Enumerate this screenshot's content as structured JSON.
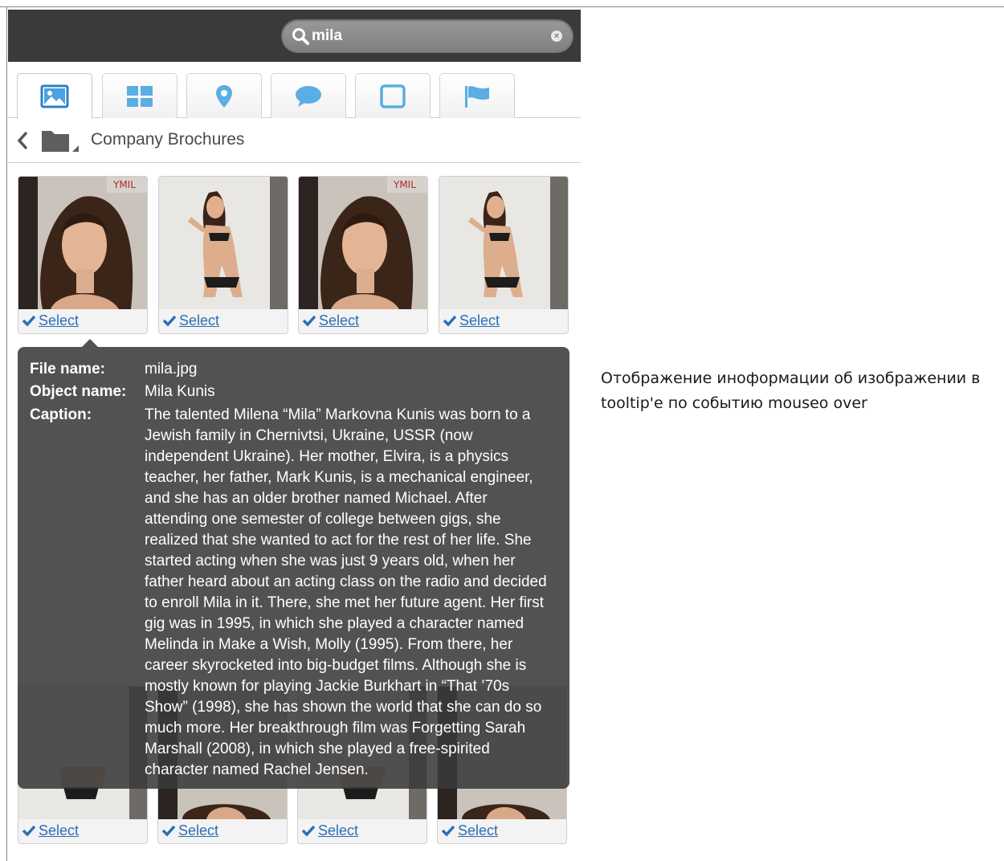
{
  "search": {
    "value": "mila"
  },
  "tabs": [
    {
      "name": "images",
      "icon": "image-icon",
      "active": true
    },
    {
      "name": "tiles",
      "icon": "grid-icon",
      "active": false
    },
    {
      "name": "location",
      "icon": "map-pin-icon",
      "active": false
    },
    {
      "name": "comments",
      "icon": "speech-bubble-icon",
      "active": false
    },
    {
      "name": "frame",
      "icon": "square-icon",
      "active": false
    },
    {
      "name": "flag",
      "icon": "flag-icon",
      "active": false
    }
  ],
  "breadcrumb": {
    "title": "Company Brochures"
  },
  "cards": {
    "select_label": "Select"
  },
  "tooltip": {
    "file_name_label": "File name:",
    "file_name": "mila.jpg",
    "object_name_label": "Object name:",
    "object_name": "Mila Kunis",
    "caption_label": "Caption:",
    "caption": "The talented Milena “Mila” Markovna Kunis was born to a Jewish family in Chernivtsi, Ukraine, USSR (now independent Ukraine). Her mother, Elvira, is a physics teacher, her father, Mark Kunis, is a mechanical engineer, and she has an older brother named Michael. After attending one semester of college between gigs, she realized that she wanted to act for the rest of her life. She started acting when she was just 9 years old, when her father heard about an acting class on the radio and decided to enroll Mila in it. There, she met her future agent. Her first gig was in 1995, in which she played a character named Melinda in Make a Wish, Molly (1995). From there, her career skyrocketed into big-budget films. Although she is mostly known for playing Jackie Burkhart in “That ’70s Show” (1998), she has shown the world that she can do so much more. Her breakthrough film was Forgetting Sarah Marshall (2008), in which she played a free-spirited character named Rachel Jensen."
  },
  "note": "Отображение иноформации об изображении в tooltip'е по событию mouseo over",
  "colors": {
    "topbar": "#3a3a3a",
    "link": "#2a6fb5",
    "tab_icon": "#4aa3df",
    "tooltip_bg": "#3a3a3a"
  }
}
